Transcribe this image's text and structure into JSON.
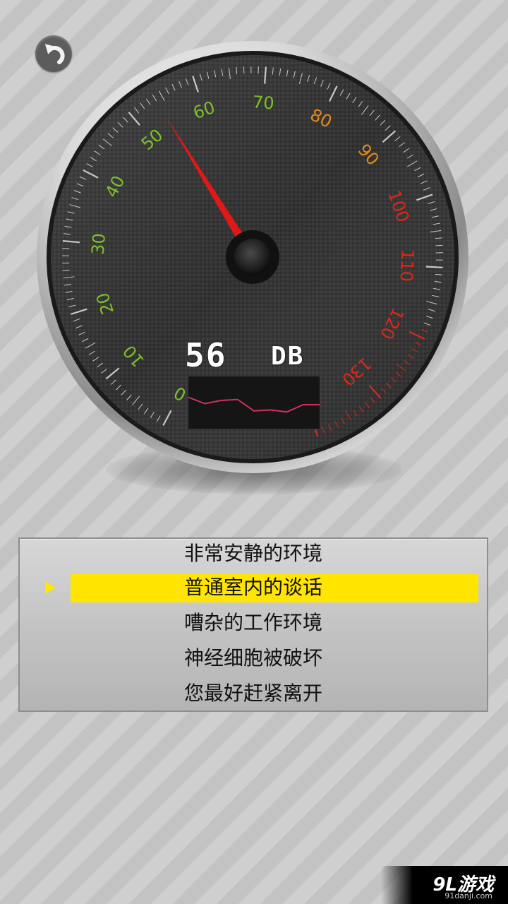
{
  "meter": {
    "value": "56",
    "unit": "DB",
    "needle_value": 54,
    "scale_min": 0,
    "scale_max": 140,
    "ticks": [
      "0",
      "10",
      "20",
      "30",
      "40",
      "50",
      "60",
      "70",
      "80",
      "90",
      "100",
      "110",
      "120",
      "130",
      "140"
    ],
    "history": [
      60,
      54,
      57,
      58,
      47,
      48,
      46,
      53,
      53
    ]
  },
  "menu": {
    "items": [
      "非常安静的环境",
      "普通室内的谈话",
      "嘈杂的工作环境",
      "神经细胞被破坏",
      "您最好赶紧离开"
    ],
    "selected_index": 1
  },
  "colors": {
    "highlight": "#ffe500",
    "needle": "#e01818",
    "tick_green": "#7fbf2a",
    "tick_orange": "#e08a1a",
    "tick_red": "#d82a1a",
    "graph_line": "#d0305a"
  },
  "icons": {
    "back": "back-arrow-icon",
    "selector": "triangle-right-icon"
  },
  "watermark": {
    "logo": "9L游戏",
    "site": "91danji.com"
  }
}
